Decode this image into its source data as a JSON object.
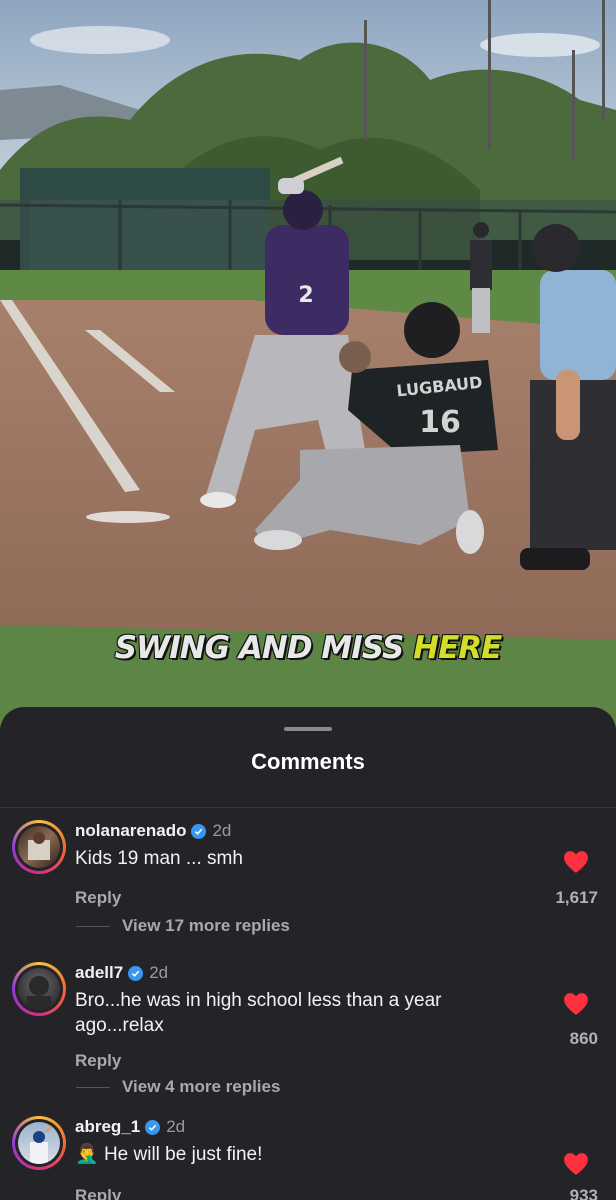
{
  "video": {
    "caption_part1": "SWING AND MISS",
    "caption_part2": "HERE",
    "jersey_batter": "2",
    "jersey_catcher_name": "LUGBAUD",
    "jersey_catcher_number": "16"
  },
  "sheet": {
    "title": "Comments"
  },
  "comments": [
    {
      "username": "nolanarenado",
      "verified": true,
      "time": "2d",
      "text": "Kids 19 man ... smh",
      "reply_label": "Reply",
      "likes": "1,617",
      "more_replies": "View 17 more replies"
    },
    {
      "username": "adell7",
      "verified": true,
      "time": "2d",
      "text": "Bro...he was in high school less than a year ago...relax",
      "reply_label": "Reply",
      "likes": "860",
      "more_replies": "View 4 more replies"
    },
    {
      "username": "abreg_1",
      "verified": true,
      "time": "2d",
      "emoji": "🤦‍♂️",
      "text": "He will be just fine!",
      "reply_label": "Reply",
      "likes": "933"
    }
  ],
  "colors": {
    "sheet_bg": "#242428",
    "heart": "#ff3040",
    "verified": "#3897f0",
    "caption_highlight": "#d4dd2a"
  }
}
